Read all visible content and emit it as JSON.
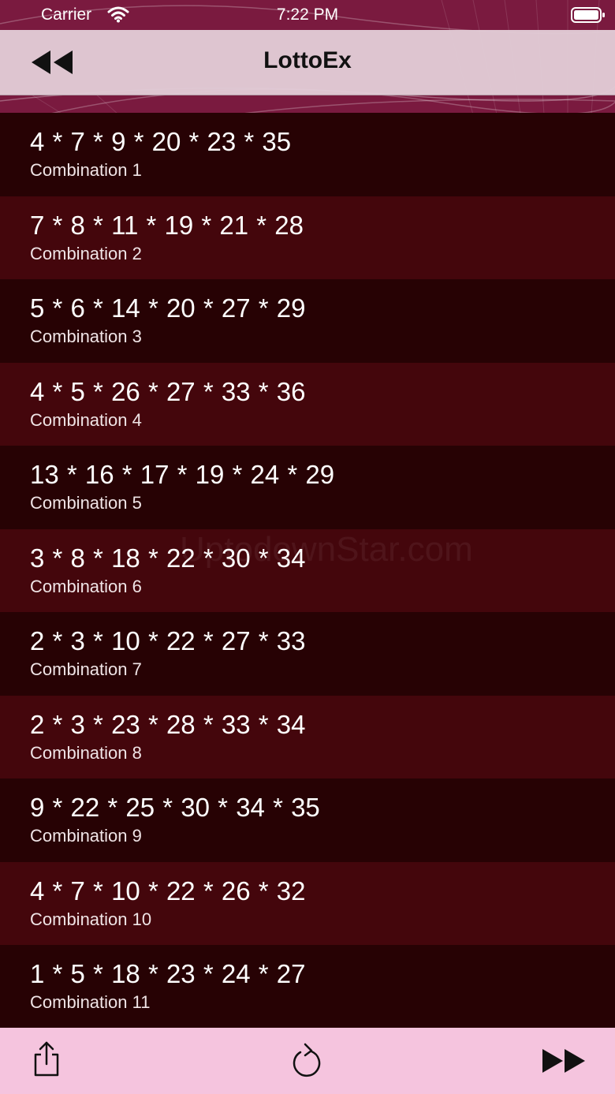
{
  "status_bar": {
    "carrier": "Carrier",
    "time": "7:22 PM"
  },
  "nav": {
    "title": "LottoEx",
    "back_icon": "rewind-icon"
  },
  "combinations": [
    {
      "numbers": "4 * 7 * 9 * 20 * 23 * 35",
      "label": "Combination 1"
    },
    {
      "numbers": "7 * 8 * 11 * 19 * 21 * 28",
      "label": "Combination 2"
    },
    {
      "numbers": "5 * 6 * 14 * 20 * 27 * 29",
      "label": "Combination 3"
    },
    {
      "numbers": "4 * 5 * 26 * 27 * 33 * 36",
      "label": "Combination 4"
    },
    {
      "numbers": "13 * 16 * 17 * 19 * 24 * 29",
      "label": "Combination 5"
    },
    {
      "numbers": "3 * 8 * 18 * 22 * 30 * 34",
      "label": "Combination 6"
    },
    {
      "numbers": "2 * 3 * 10 * 22 * 27 * 33",
      "label": "Combination 7"
    },
    {
      "numbers": "2 * 3 * 23 * 28 * 33 * 34",
      "label": "Combination 8"
    },
    {
      "numbers": "9 * 22 * 25 * 30 * 34 * 35",
      "label": "Combination 9"
    },
    {
      "numbers": "4 * 7 * 10 * 22 * 26 * 32",
      "label": "Combination 10"
    },
    {
      "numbers": "1 * 5 * 18 * 23 * 24 * 27",
      "label": "Combination 11"
    }
  ],
  "watermark": "UptodownStar.com",
  "toolbar": {
    "share_icon": "share-icon",
    "refresh_icon": "refresh-icon",
    "forward_icon": "fast-forward-icon"
  },
  "colors": {
    "row_dark": "#270204",
    "row_light": "#44060c",
    "header_bg": "#7a1a3f",
    "nav_bg": "#e2ccd6",
    "toolbar_bg": "#f5c4de"
  }
}
